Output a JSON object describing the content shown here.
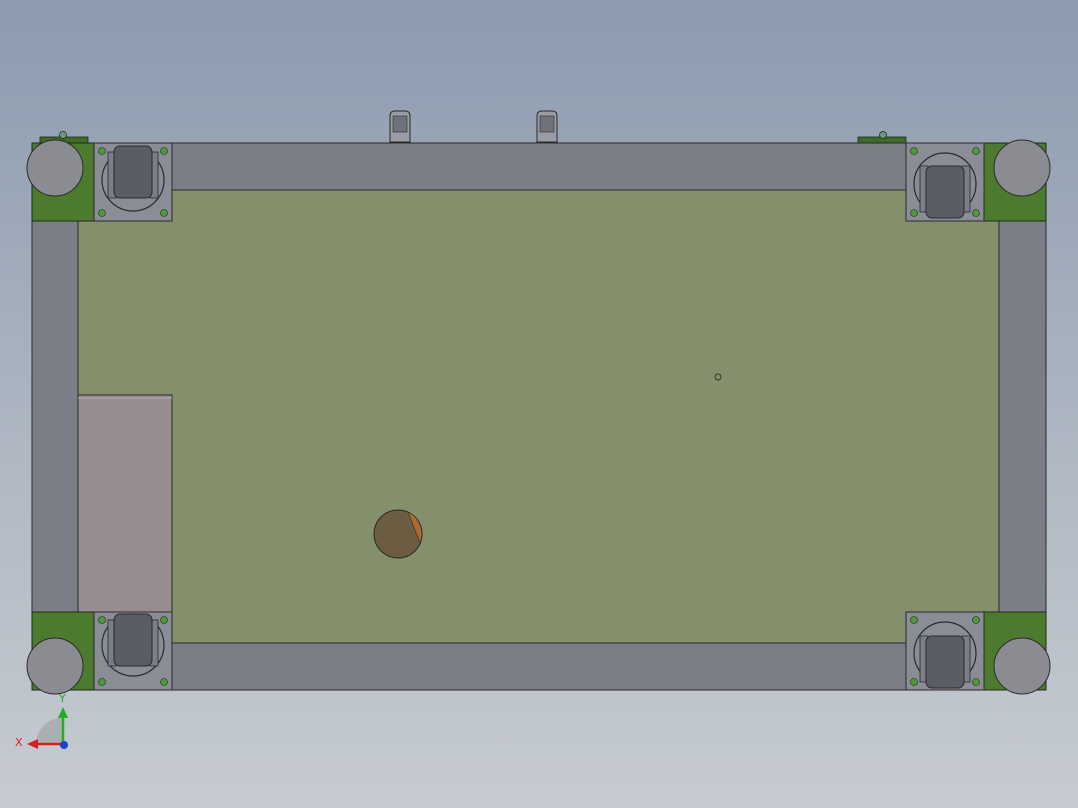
{
  "viewport": {
    "colors": {
      "background_top": "#8c9bb0",
      "background_bottom": "#c6cbd1",
      "plate": "#848f6c",
      "frame_tube": "#7b7d87",
      "corner_bracket": "#4c7a2e",
      "caster_plate": "#8a8d96",
      "caster_wheel": "#5a5d66",
      "leveling_foot": "#8a8c92",
      "side_panel": "#978c8f",
      "round_hole": "#6b5c42",
      "outline": "#2a2a2a"
    },
    "icons": {
      "triad": "coordinate-triad-icon",
      "caster": "caster-wheel-icon",
      "foot": "leveling-foot-icon",
      "handle": "handle-bracket-icon"
    }
  },
  "triad": {
    "x_label": "X",
    "y_label": "Y",
    "x_color": "#d92020",
    "y_color": "#20b020",
    "z_color": "#2040d0"
  }
}
